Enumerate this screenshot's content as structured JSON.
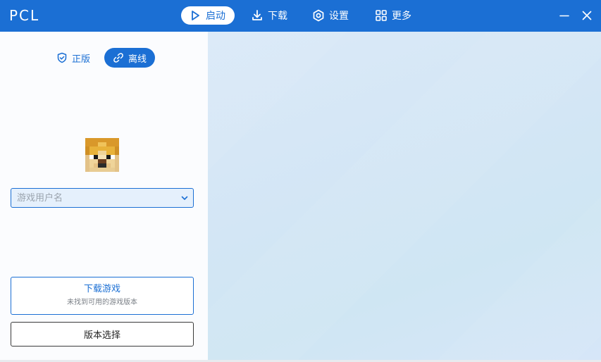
{
  "app": {
    "title": "PCL"
  },
  "nav": {
    "launch": "启动",
    "download": "下载",
    "settings": "设置",
    "more": "更多"
  },
  "login_mode": {
    "genuine": "正版",
    "offline": "离线",
    "selected": "offline"
  },
  "username": {
    "value": "",
    "placeholder": "游戏用户名"
  },
  "download_game": {
    "title": "下载游戏",
    "subtitle": "未找到可用的游戏版本"
  },
  "version_select": {
    "label": "版本选择"
  },
  "icons": {
    "launch": "play-icon",
    "download": "download-icon",
    "settings": "gear-icon",
    "more": "grid-icon",
    "genuine": "shield-check-icon",
    "offline": "link-icon",
    "minimize": "minimize-icon",
    "close": "close-icon"
  },
  "colors": {
    "accent": "#1b6fd4",
    "titlebar": "#1b6fd4",
    "input_bg": "#e5f0fc"
  }
}
